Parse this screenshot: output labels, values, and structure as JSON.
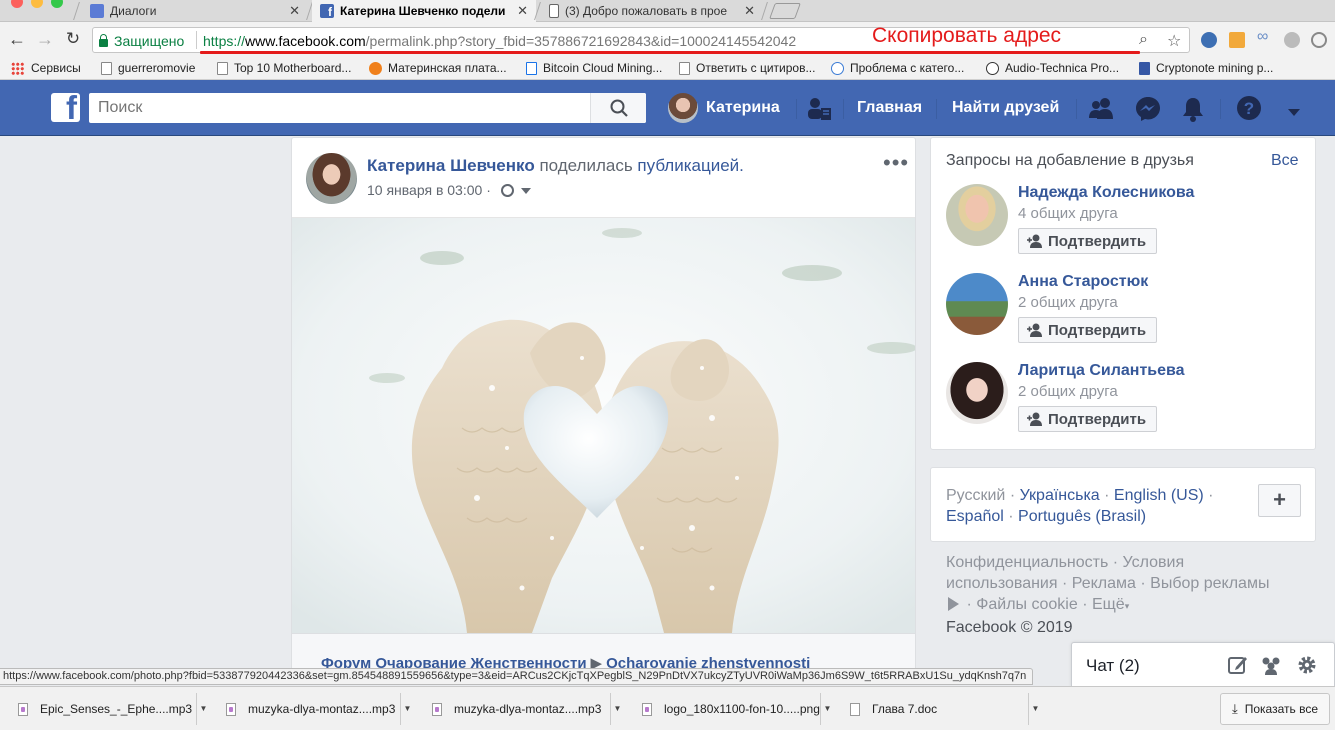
{
  "browser": {
    "tabs": [
      {
        "title": "Диалоги"
      },
      {
        "title": "Катерина Шевченко подели"
      },
      {
        "title": "(3) Добро пожаловать в прое"
      }
    ],
    "secure_label": "Защищено",
    "url": {
      "scheme": "https://",
      "host": "www.facebook.com",
      "path": "/permalink.php?story_fbid=357886721692843&id=100024145542042"
    },
    "annotation": "Скопировать адрес",
    "bookmarks": [
      "Сервисы",
      "guerreromovie",
      "Top 10 Motherboard...",
      "Материнская плата...",
      "Bitcoin Cloud Mining...",
      "Ответить с цитиров...",
      "Проблема с катего...",
      "Audio-Technica Pro...",
      "Cryptonote mining p..."
    ],
    "status_url": "https://www.facebook.com/photo.php?fbid=533877920442336&set=gm.854548891559656&type=3&eid=ARCus2CKjcTqXPegblS_N29PnDtVX7ukcyZTyUVR0iWaMp36Jm6S9W_t6t5RRABxU1Su_ydqKnsh7q7n",
    "downloads": [
      "Epic_Senses_-_Ephe....mp3",
      "muzyka-dlya-montaz....mp3",
      "muzyka-dlya-montaz....mp3",
      "logo_180x1100-fon-10.....png",
      "Глава 7.doc"
    ],
    "show_all": "Показать все"
  },
  "fb": {
    "search_placeholder": "Поиск",
    "profile_name": "Катерина",
    "nav_home": "Главная",
    "nav_find_friends": "Найти друзей",
    "brand_color": "#4267b2",
    "link_color": "#365899"
  },
  "post": {
    "author": "Катерина Шевченко",
    "action": "поделилась",
    "action_link": "публикацией.",
    "time": "10 января в 03:00 ·",
    "share_source": "Форум Очарование Женственности",
    "share_target": "Ocharovanie zhenstvennosti"
  },
  "friend_requests": {
    "title": "Запросы на добавление в друзья",
    "see_all": "Все",
    "items": [
      {
        "name": "Надежда Колесникова",
        "mutual": "4 общих друга",
        "button": "Подтвердить"
      },
      {
        "name": "Анна Старостюк",
        "mutual": "2 общих друга",
        "button": "Подтвердить"
      },
      {
        "name": "Ларитца Силантьева",
        "mutual": "2 общих друга",
        "button": "Подтвердить"
      }
    ]
  },
  "languages": {
    "current": "Русский",
    "others": [
      "Українська",
      "English (US)",
      "Español",
      "Português (Brasil)"
    ]
  },
  "footer": {
    "links": [
      "Конфиденциальность",
      "Условия использования",
      "Реклама",
      "Выбор рекламы",
      "Файлы cookie",
      "Ещё"
    ],
    "copyright": "Facebook © 2019"
  },
  "chat": {
    "label": "Чат (2)"
  }
}
